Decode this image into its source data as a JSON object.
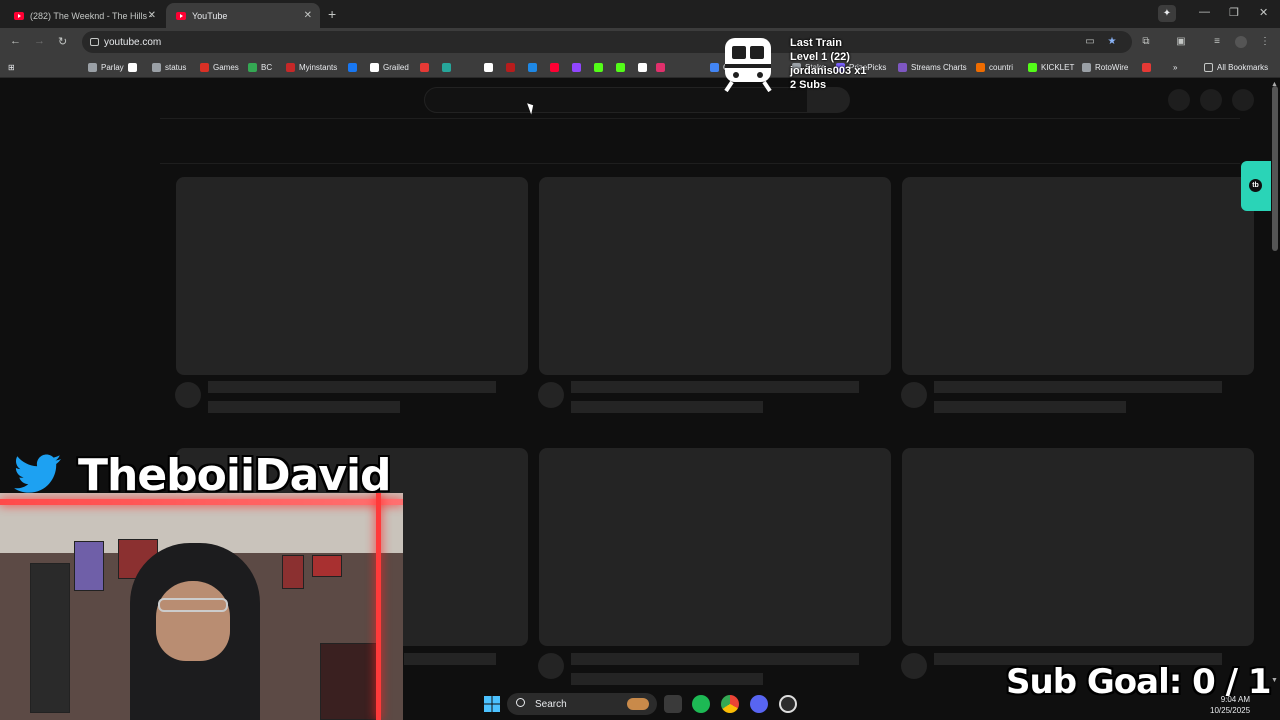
{
  "browser": {
    "tabs": [
      {
        "title": "(282) The Weeknd - The Hills -",
        "active": false
      },
      {
        "title": "YouTube",
        "active": true
      }
    ],
    "url": "youtube.com",
    "bookmarks": [
      {
        "label": "Parlay",
        "color": "#9aa0a6"
      },
      {
        "label": "",
        "color": "#ffffff"
      },
      {
        "label": "status",
        "color": "#9aa0a6"
      },
      {
        "label": "Games",
        "color": "#d93025"
      },
      {
        "label": "BC",
        "color": "#34a853"
      },
      {
        "label": "Myinstants",
        "color": "#c62828"
      },
      {
        "label": "",
        "color": "#1877f2"
      },
      {
        "label": "Grailed",
        "color": "#ffffff"
      },
      {
        "label": "",
        "color": "#e53935"
      },
      {
        "label": "",
        "color": "#26a69a"
      },
      {
        "label": "",
        "color": "#ffffff"
      },
      {
        "label": "",
        "color": "#b71c1c"
      },
      {
        "label": "",
        "color": "#1e88e5"
      },
      {
        "label": "",
        "color": "#ff0033"
      },
      {
        "label": "",
        "color": "#9146ff"
      },
      {
        "label": "",
        "color": "#53fc18"
      },
      {
        "label": "",
        "color": "#53fc18"
      },
      {
        "label": "",
        "color": "#ffffff"
      },
      {
        "label": "",
        "color": "#e1306c"
      },
      {
        "label": "Google",
        "color": "#4285f4"
      },
      {
        "label": "",
        "color": "#0078d4"
      }
    ],
    "bookmarks_right": [
      {
        "label": "Stake",
        "color": "#9aa0a6"
      },
      {
        "label": "PrizePicks",
        "color": "#7b61ff"
      },
      {
        "label": "Streams Charts",
        "color": "#7e57c2"
      },
      {
        "label": "countri",
        "color": "#ef6c00"
      },
      {
        "label": "KICKLET",
        "color": "#53fc18"
      },
      {
        "label": "RotoWire",
        "color": "#9aa0a6"
      },
      {
        "label": "",
        "color": "#e53935"
      }
    ],
    "all_bookmarks_label": "All Bookmarks"
  },
  "overlay": {
    "train_title": "Last Train",
    "train_level": "Level 1  (22)",
    "train_user": "jordanis003 x1",
    "train_subs": "2 Subs",
    "twitter_handle": "TheboiiDavid",
    "sub_goal": "Sub Goal:  0 / 1"
  },
  "taskbar": {
    "search_label": "Search",
    "time": "9:04 AM",
    "date": "10/25/2025"
  },
  "colors": {
    "accent_extension": "#2ad4b7",
    "youtube_red": "#ff0033"
  }
}
